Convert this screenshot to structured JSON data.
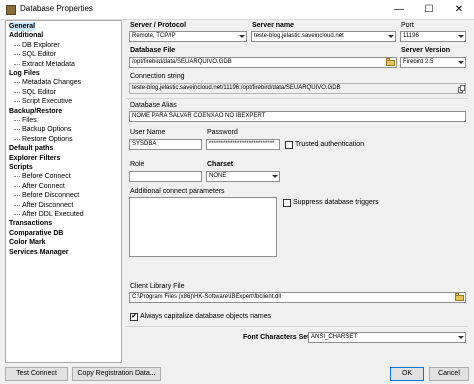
{
  "window": {
    "title": "Database Properties",
    "minimize_glyph": "—",
    "maximize_glyph": "☐",
    "close_glyph": "✕"
  },
  "tree": [
    {
      "label": "General",
      "bold": true,
      "selected": true
    },
    {
      "label": "Additional",
      "bold": true
    },
    {
      "label": "DB Explorer"
    },
    {
      "label": "SQL Editor"
    },
    {
      "label": "Extract Metadata"
    },
    {
      "label": "Log Files",
      "bold": true
    },
    {
      "label": "Metadata Changes"
    },
    {
      "label": "SQL Editor"
    },
    {
      "label": "Script Executive"
    },
    {
      "label": "Backup/Restore",
      "bold": true
    },
    {
      "label": "Files"
    },
    {
      "label": "Backup Options"
    },
    {
      "label": "Restore Options"
    },
    {
      "label": "Default paths",
      "bold": true
    },
    {
      "label": "Explorer Filters",
      "bold": true
    },
    {
      "label": "Scripts",
      "bold": true
    },
    {
      "label": "Before Connect"
    },
    {
      "label": "After Connect"
    },
    {
      "label": "Before Disconnect"
    },
    {
      "label": "After Disconnect"
    },
    {
      "label": "After DDL Executed"
    },
    {
      "label": "Transactions",
      "bold": true
    },
    {
      "label": "Comparative DB",
      "bold": true
    },
    {
      "label": "Color Mark",
      "bold": true
    },
    {
      "label": "Services Manager",
      "bold": true
    }
  ],
  "form": {
    "server_protocol_label": "Server / Protocol",
    "server_protocol_value": "Remote, TCP/IP",
    "server_name_label": "Server name",
    "server_name_value": "teste-blog.jelastic.saveincloud.net",
    "port_label": "Port",
    "port_value": "11196",
    "db_file_label": "Database File",
    "db_file_value": "/opt/firebird/data/SEUARQUIVO.GDB",
    "server_version_label": "Server Version",
    "server_version_value": "Firebird 2.5",
    "connection_string_label": "Connection string",
    "connection_string_value": "teste-blog.jelastic.saveincloud.net/11196:/opt/firebird/data/SEUARQUIVO.GDB",
    "db_alias_label": "Database Alias",
    "db_alias_value": "NOME PARA SALVAR COENXÃO NO IBEXPERT",
    "user_name_label": "User Name",
    "user_name_value": "SYSDBA",
    "password_label": "Password",
    "password_value": "****************************",
    "trusted_auth_label": "Trusted authentication",
    "role_label": "Role",
    "role_value": "",
    "charset_label": "Charset",
    "charset_value": "NONE",
    "additional_params_label": "Additional connect parameters",
    "suppress_triggers_label": "Suppress database triggers",
    "client_library_label": "Client Library File",
    "client_library_value": "C:\\Program Files (x86)\\HK-Software\\IBExpert\\fbclient.dll",
    "capitalize_label": "Always capitalize database objects names",
    "capitalize_checked": "✔",
    "font_charset_label": "Font Characters Set",
    "font_charset_value": "ANSI_CHARSET"
  },
  "buttons": {
    "test_connect": "Test Connect",
    "copy_registration": "Copy Registration Data...",
    "ok": "OK",
    "cancel": "Cancel"
  },
  "icons": {
    "folder": "folder-icon",
    "copy": "copy-icon",
    "app": "database-icon"
  }
}
